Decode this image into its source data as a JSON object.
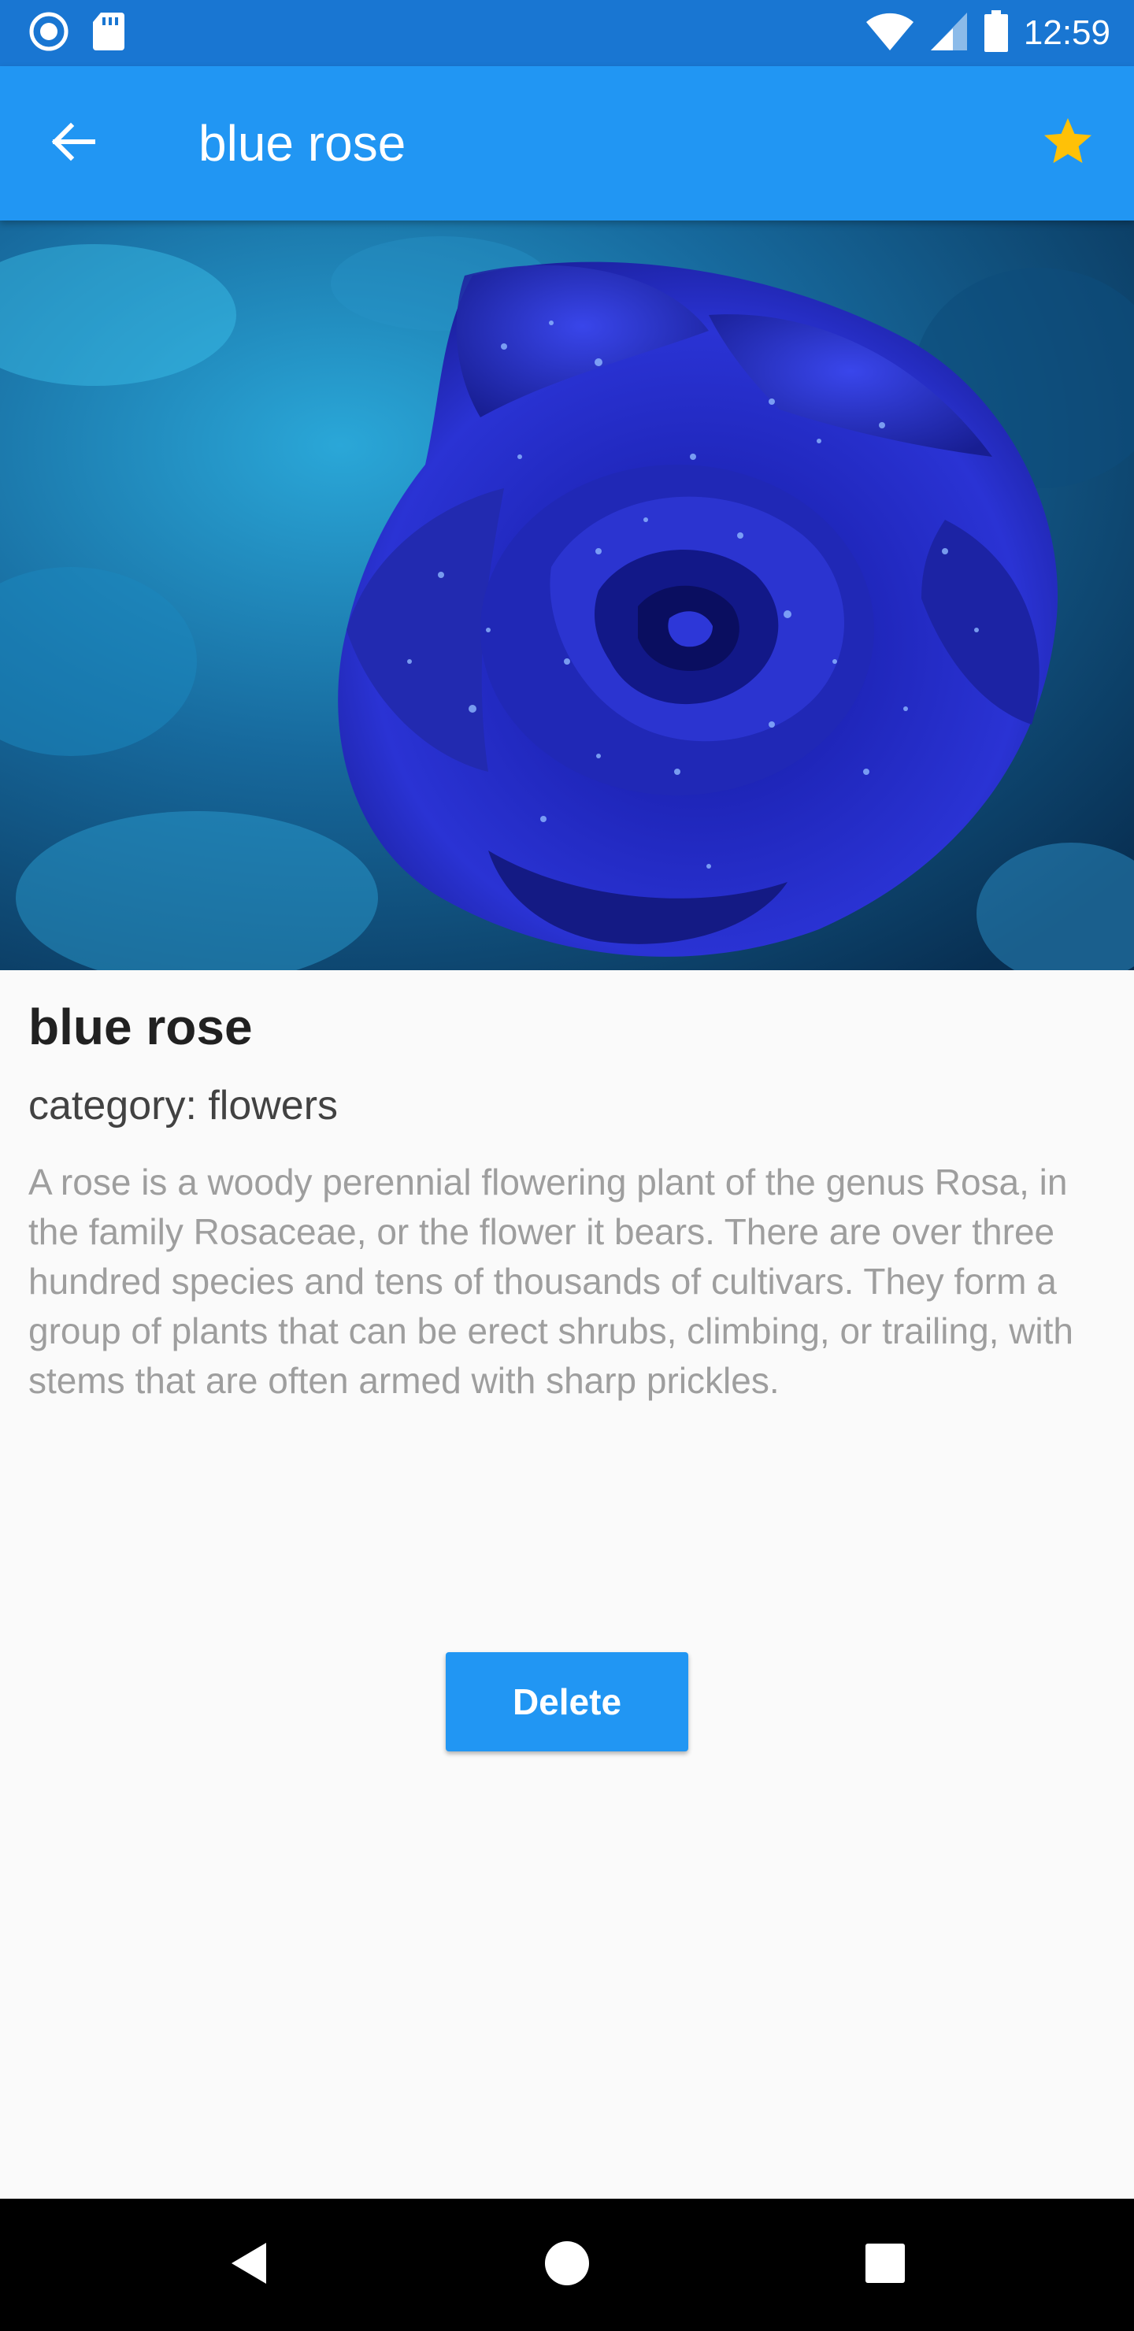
{
  "status_bar": {
    "time": "12:59",
    "icons": [
      "radio-button-icon",
      "sd-card-icon",
      "wifi-icon",
      "signal-icon",
      "battery-icon"
    ]
  },
  "app_bar": {
    "title": "blue rose",
    "back_icon": "arrow-back-icon",
    "favorite_icon": "star-icon",
    "favorite_active": true,
    "background_color": "#2196f3",
    "star_color": "#ffc107"
  },
  "detail": {
    "image_subject": "blue-rose-photo",
    "name": "blue rose",
    "category": "category: flowers",
    "description": "A rose is a woody perennial flowering plant of the genus Rosa, in the family Rosaceae, or the flower it bears. There are over three hundred species and tens of thousands of cultivars. They form a group of plants that can be erect shrubs, climbing, or trailing, with stems that are often armed with sharp prickles."
  },
  "actions": {
    "delete_label": "Delete",
    "button_color": "#2196f3"
  },
  "nav_bar": {
    "icons": [
      "nav-back-icon",
      "nav-home-icon",
      "nav-recents-icon"
    ]
  }
}
